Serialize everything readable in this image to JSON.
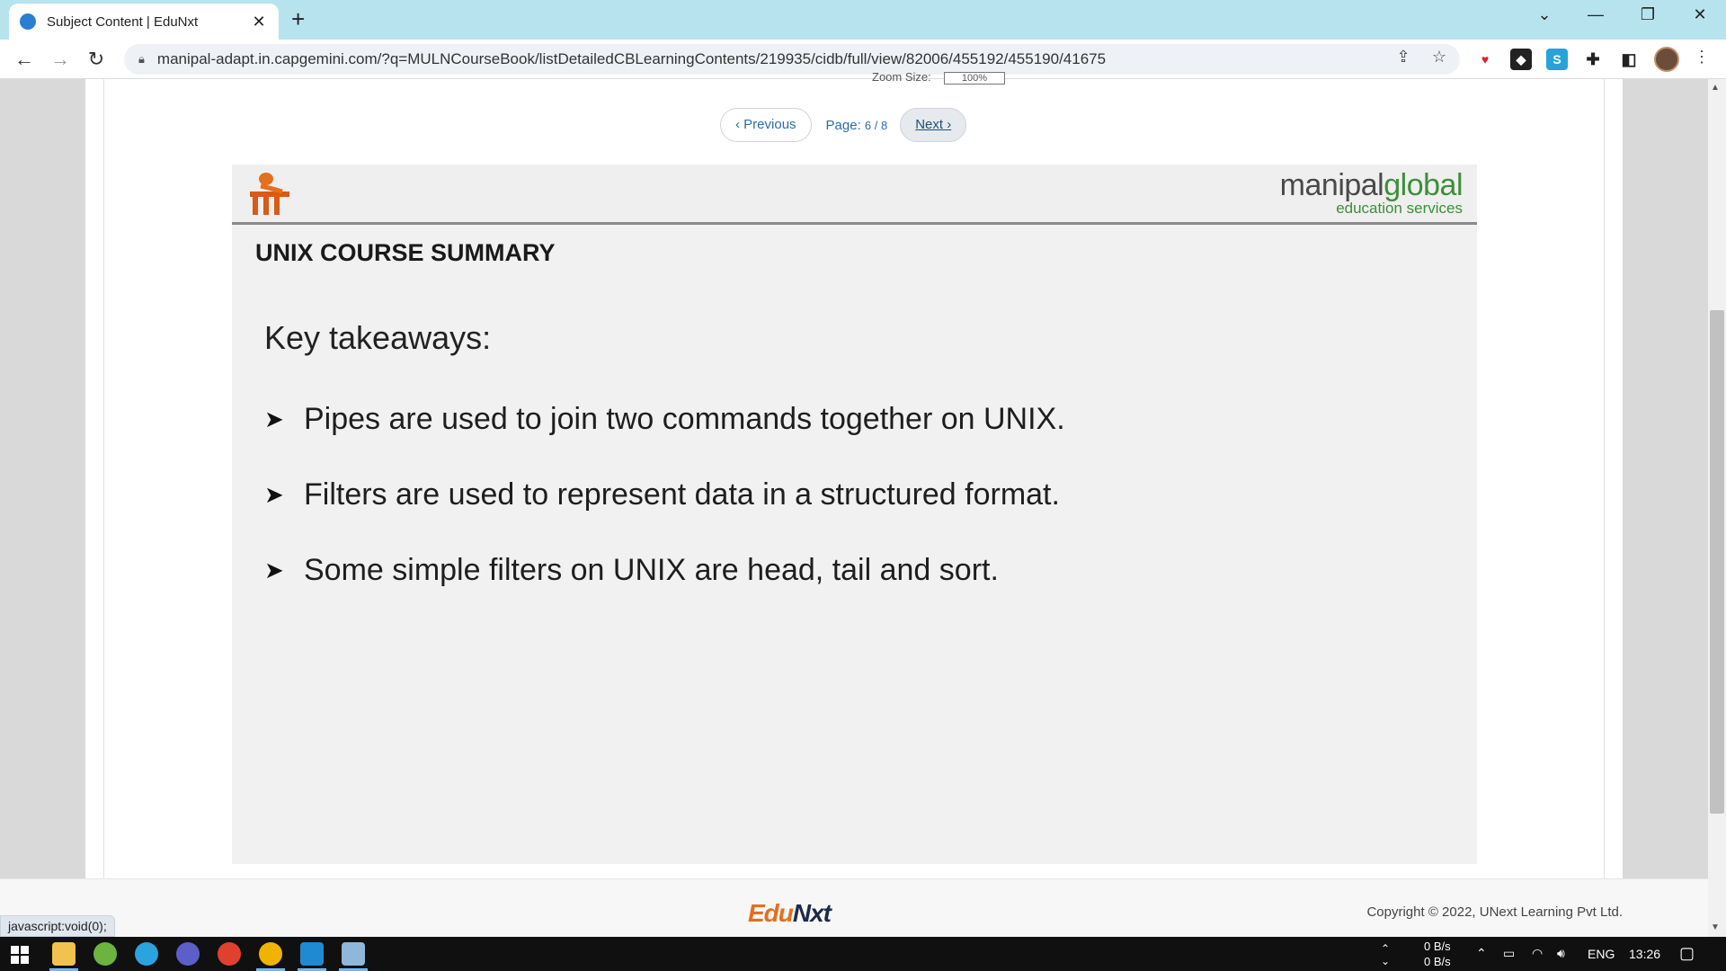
{
  "browser": {
    "tab_title": "Subject Content | EduNxt",
    "tab_close": "✕",
    "new_tab": "+",
    "url": "manipal-adapt.in.capgemini.com/?q=MULNCourseBook/listDetailedCBLearningContents/219935/cidb/full/view/82006/455192/455190/41675",
    "status_url": "javascript:void(0);"
  },
  "viewer": {
    "zoom_label": "Zoom Size:",
    "zoom_value": "100%",
    "prev_label": "Previous",
    "page_label": "Page:",
    "page_value": "6 / 8",
    "next_label": "Next"
  },
  "slide": {
    "brand_main_1": "manipal",
    "brand_main_2": "global",
    "brand_sub": "education services",
    "title": "UNIX COURSE SUMMARY",
    "heading": "Key takeaways:",
    "bullets": [
      "Pipes are used to join two commands together on UNIX.",
      "Filters are used to represent data in a structured format.",
      "Some simple filters on UNIX are head, tail and sort."
    ]
  },
  "footer": {
    "logo_edu": "Edu",
    "logo_nxt": "Nxt",
    "copyright": "Copyright © 2022, UNext Learning Pvt Ltd."
  },
  "taskbar": {
    "net_up": "0 B/s",
    "net_down": "0 B/s",
    "lang": "ENG",
    "time": "13:26"
  }
}
